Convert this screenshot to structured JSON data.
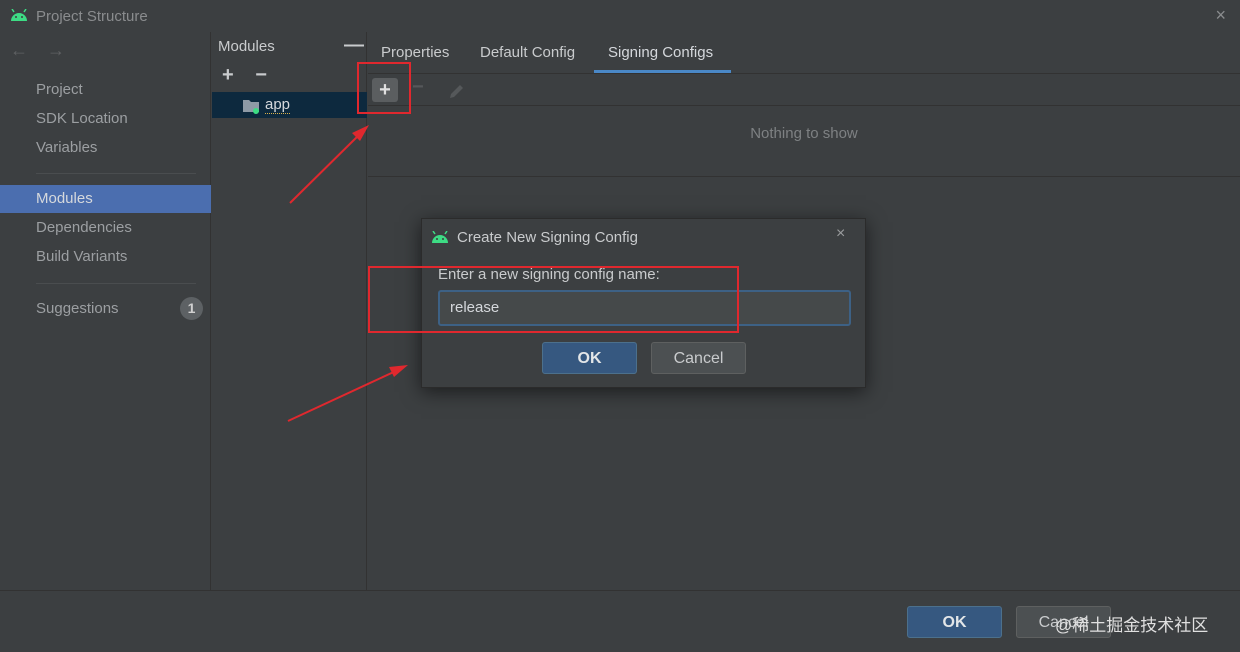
{
  "window": {
    "title": "Project Structure",
    "app_icon": "android-icon",
    "close_glyph": "×"
  },
  "nav": {
    "back_glyph": "←",
    "forward_glyph": "→",
    "items": [
      {
        "label": "Project"
      },
      {
        "label": "SDK Location"
      },
      {
        "label": "Variables"
      },
      {
        "label": "Modules",
        "selected": true
      },
      {
        "label": "Dependencies"
      },
      {
        "label": "Build Variants"
      },
      {
        "label": "Suggestions",
        "badge": "1"
      }
    ]
  },
  "modules_panel": {
    "header": "Modules",
    "collapse_glyph": "—",
    "add_glyph": "+",
    "remove_glyph": "−",
    "items": [
      {
        "label": "app",
        "selected": true
      }
    ]
  },
  "main": {
    "tabs": [
      {
        "label": "Properties"
      },
      {
        "label": "Default Config"
      },
      {
        "label": "Signing Configs",
        "active": true
      }
    ],
    "add_glyph": "+",
    "remove_glyph": "−",
    "empty_text": "Nothing to show"
  },
  "dialog": {
    "title": "Create New Signing Config",
    "close_glyph": "×",
    "prompt": "Enter a new signing config name:",
    "input_value": "release",
    "ok_label": "OK",
    "cancel_label": "Cancel"
  },
  "footer": {
    "ok_label": "OK",
    "cancel_label": "Cancel"
  },
  "watermark": "@稀土掘金技术社区",
  "colors": {
    "selection": "#4b6eaf",
    "accent_tab": "#4a88c7",
    "annotation": "#e0282e",
    "android_green": "#3ddc84"
  }
}
